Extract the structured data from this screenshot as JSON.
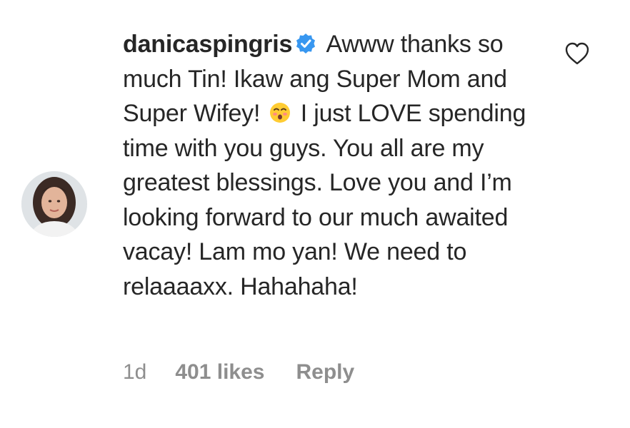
{
  "comment": {
    "username": "danicaspingris",
    "verified_icon": "verified-badge-icon",
    "text_part1": "Awww thanks so much Tin! Ikaw ang Super Mom and Super Wifey!",
    "emoji_icon": "kissing-face-emoji-icon",
    "text_part2": "I just LOVE spending time with you guys. You all are my greatest blessings. Love you and I’m looking forward to our much awaited vacay! Lam mo yan! We need to relaaaaxx. Hahahaha!"
  },
  "meta": {
    "time": "1d",
    "likes": "401 likes",
    "reply": "Reply"
  },
  "icons": {
    "like": "heart-outline-icon",
    "avatar": "profile-avatar"
  },
  "colors": {
    "text": "#262626",
    "muted": "#8e8e8e",
    "verified": "#3897f0"
  }
}
